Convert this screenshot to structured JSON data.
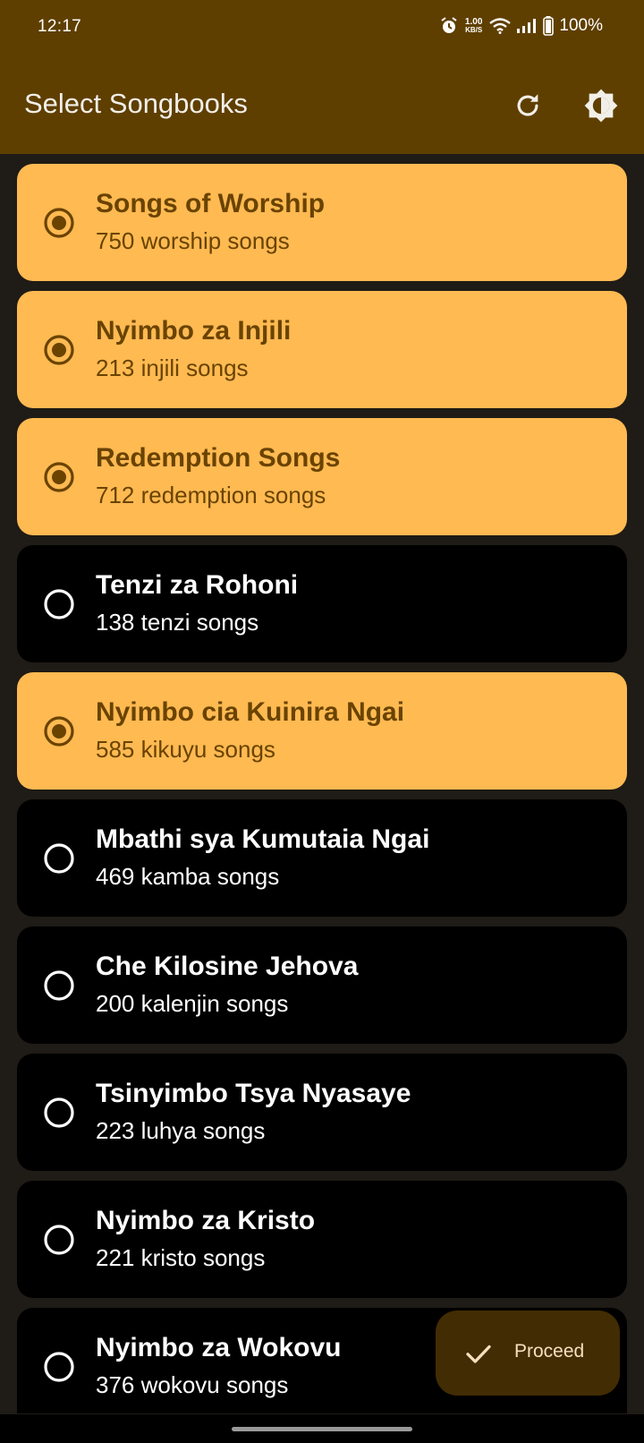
{
  "status_bar": {
    "time": "12:17",
    "net_speed_value": "1.00",
    "net_speed_unit": "KB/S",
    "battery": "100%"
  },
  "app_bar": {
    "title": "Select Songbooks"
  },
  "songbooks": [
    {
      "name": "Songs of Worship",
      "subtitle": "750 worship songs",
      "selected": true
    },
    {
      "name": "Nyimbo za Injili",
      "subtitle": "213 injili songs",
      "selected": true
    },
    {
      "name": "Redemption Songs",
      "subtitle": "712 redemption songs",
      "selected": true
    },
    {
      "name": "Tenzi za Rohoni",
      "subtitle": "138 tenzi songs",
      "selected": false
    },
    {
      "name": "Nyimbo cia Kuinira Ngai",
      "subtitle": "585 kikuyu songs",
      "selected": true
    },
    {
      "name": "Mbathi sya Kumutaia Ngai",
      "subtitle": "469 kamba songs",
      "selected": false
    },
    {
      "name": "Che Kilosine Jehova",
      "subtitle": "200 kalenjin songs",
      "selected": false
    },
    {
      "name": "Tsinyimbo Tsya Nyasaye",
      "subtitle": "223 luhya songs",
      "selected": false
    },
    {
      "name": "Nyimbo za Kristo",
      "subtitle": "221 kristo songs",
      "selected": false
    },
    {
      "name": "Nyimbo za Wokovu",
      "subtitle": "376 wokovu songs",
      "selected": false
    }
  ],
  "fab": {
    "label": "Proceed"
  },
  "colors": {
    "primary": "#5f3f00",
    "selected_bg": "#ffba52",
    "selected_text": "#6a4300",
    "unselected_bg": "#000000",
    "fab_bg": "#422c03"
  }
}
